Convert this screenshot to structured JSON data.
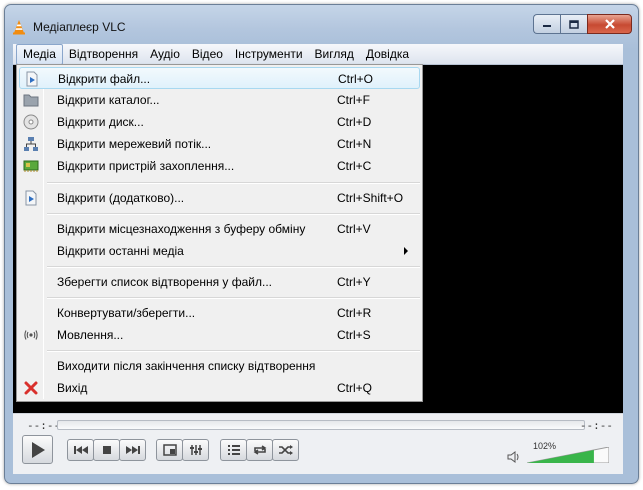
{
  "window": {
    "title": "Медіаплеєр VLC",
    "icon": "vlc-cone-icon"
  },
  "menubar": {
    "items": [
      {
        "label": "Медіа",
        "active": true
      },
      {
        "label": "Відтворення"
      },
      {
        "label": "Аудіо"
      },
      {
        "label": "Відео"
      },
      {
        "label": "Інструменти"
      },
      {
        "label": "Вигляд"
      },
      {
        "label": "Довідка"
      }
    ]
  },
  "media_menu": {
    "items": [
      {
        "label": "Відкрити файл...",
        "shortcut": "Ctrl+O",
        "icon": "file-icon",
        "highlighted": true
      },
      {
        "label": "Відкрити каталог...",
        "shortcut": "Ctrl+F",
        "icon": "folder-icon"
      },
      {
        "label": "Відкрити диск...",
        "shortcut": "Ctrl+D",
        "icon": "disc-icon"
      },
      {
        "label": "Відкрити мережевий потік...",
        "shortcut": "Ctrl+N",
        "icon": "network-icon"
      },
      {
        "label": "Відкрити пристрій захоплення...",
        "shortcut": "Ctrl+C",
        "icon": "capture-card-icon"
      },
      {
        "label": "Відкрити (додатково)...",
        "shortcut": "Ctrl+Shift+O",
        "icon": "file-icon"
      },
      {
        "label": "Відкрити місцезнаходження з буферу обміну",
        "shortcut": "Ctrl+V"
      },
      {
        "label": "Відкрити останні медіа",
        "shortcut": "",
        "submenu": true
      },
      {
        "label": "Зберегти список відтворення у файл...",
        "shortcut": "Ctrl+Y"
      },
      {
        "label": "Конвертувати/зберегти...",
        "shortcut": "Ctrl+R"
      },
      {
        "label": "Мовлення...",
        "shortcut": "Ctrl+S",
        "icon": "broadcast-icon"
      },
      {
        "label": "Виходити після закінчення списку відтворення",
        "shortcut": ""
      },
      {
        "label": "Вихід",
        "shortcut": "Ctrl+Q",
        "icon": "exit-x-icon"
      }
    ]
  },
  "controls": {
    "time_elapsed": "--:--",
    "time_remaining": "--:--",
    "volume_label": "102%",
    "volume_level": 1.02
  },
  "colors": {
    "video_bg": "#000000",
    "menu_highlight": "#e0f1fb",
    "exit_icon": "#d9302c",
    "volume_fill": "#39b54a"
  }
}
